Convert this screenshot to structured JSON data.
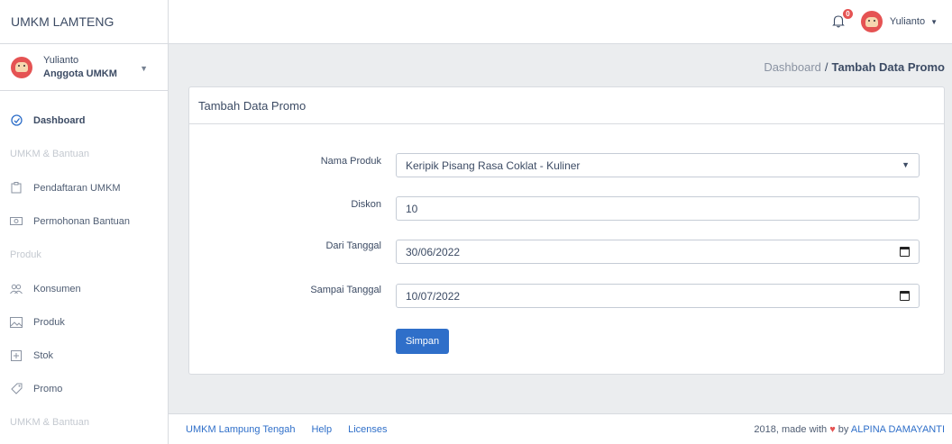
{
  "brand": "UMKM LAMTENG",
  "user_panel": {
    "name": "Yulianto",
    "role": "Anggota UMKM"
  },
  "sidebar": {
    "items": [
      {
        "type": "item",
        "label": "Dashboard",
        "icon": "speedometer-icon",
        "active": true
      },
      {
        "type": "title",
        "label": "UMKM & Bantuan"
      },
      {
        "type": "item",
        "label": "Pendaftaran UMKM",
        "icon": "clipboard-icon"
      },
      {
        "type": "item",
        "label": "Permohonan Bantuan",
        "icon": "money-icon"
      },
      {
        "type": "title",
        "label": "Produk"
      },
      {
        "type": "item",
        "label": "Konsumen",
        "icon": "people-icon"
      },
      {
        "type": "item",
        "label": "Produk",
        "icon": "image-icon"
      },
      {
        "type": "item",
        "label": "Stok",
        "icon": "plus-box-icon"
      },
      {
        "type": "item",
        "label": "Promo",
        "icon": "tag-icon"
      },
      {
        "type": "title",
        "label": "UMKM & Bantuan"
      }
    ]
  },
  "header": {
    "notification_count": "0",
    "user_name": "Yulianto"
  },
  "breadcrumb": {
    "parent": "Dashboard",
    "separator": "/",
    "current": "Tambah Data Promo"
  },
  "card": {
    "title": "Tambah Data Promo",
    "fields": {
      "produk": {
        "label": "Nama Produk",
        "value": "Keripik Pisang Rasa Coklat - Kuliner"
      },
      "diskon": {
        "label": "Diskon",
        "value": "10"
      },
      "dari": {
        "label": "Dari Tanggal",
        "value": "30/06/2022"
      },
      "sampai": {
        "label": "Sampai Tanggal",
        "value": "10/07/2022"
      }
    },
    "submit_label": "Simpan"
  },
  "footer": {
    "links": [
      "UMKM Lampung Tengah",
      "Help",
      "Licenses"
    ],
    "credit_prefix": "2018, made with",
    "credit_middle": "by",
    "credit_author": "ALPINA DAMAYANTI"
  },
  "colors": {
    "primary": "#2f6fc9",
    "danger": "#e55353",
    "background": "#ebedef"
  }
}
